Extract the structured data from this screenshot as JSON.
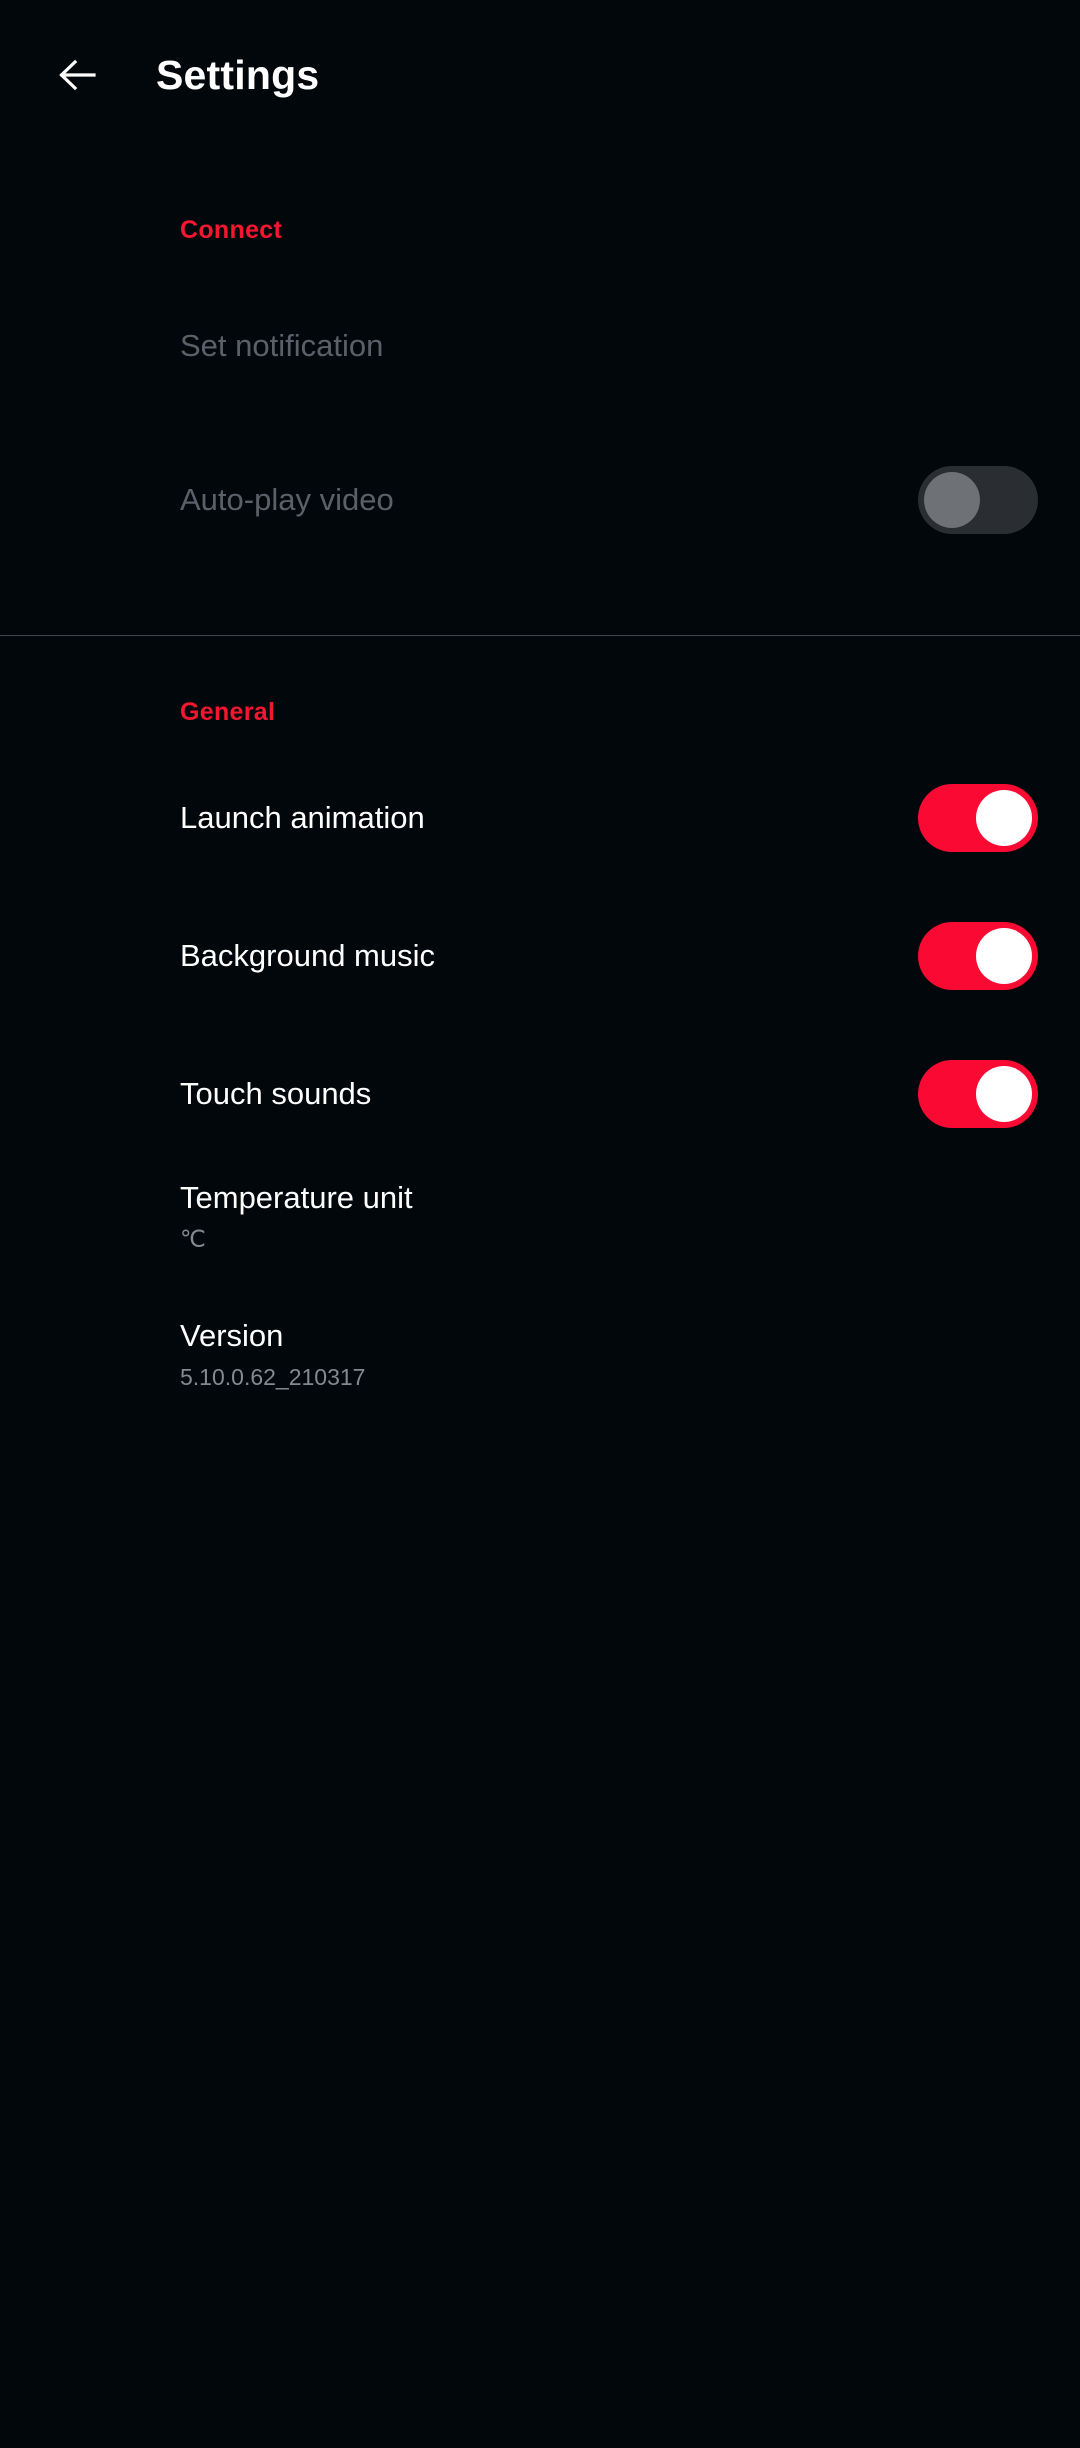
{
  "header": {
    "back_icon": "arrow-left-icon",
    "title": "Settings"
  },
  "sections": [
    {
      "id": "connect",
      "title": "Connect",
      "rows": [
        {
          "label": "Set notification",
          "sub": "",
          "control": "none",
          "enabled": false
        },
        {
          "label": "Auto-play video",
          "sub": "",
          "control": "toggle",
          "toggle_state": "off",
          "enabled": false
        }
      ]
    },
    {
      "id": "general",
      "title": "General",
      "rows": [
        {
          "label": "Launch animation",
          "sub": "",
          "control": "toggle",
          "toggle_state": "on",
          "enabled": true
        },
        {
          "label": "Background music",
          "sub": "",
          "control": "toggle",
          "toggle_state": "on",
          "enabled": true
        },
        {
          "label": "Touch sounds",
          "sub": "",
          "control": "toggle",
          "toggle_state": "on",
          "enabled": true
        },
        {
          "label": "Temperature unit",
          "sub": "℃",
          "control": "none",
          "enabled": true
        },
        {
          "label": "Version",
          "sub": "5.10.0.62_210317",
          "control": "none",
          "enabled": true
        }
      ]
    }
  ],
  "colors": {
    "background": "#02070c",
    "accent_red": "#f5162f",
    "toggle_on": "#fa0a32",
    "toggle_off_track": "#2a2d31",
    "toggle_off_thumb": "#6e7175",
    "label": "#ffffff",
    "label_disabled": "#5b6068",
    "sublabel": "#828990",
    "divider": "#4a5058"
  }
}
